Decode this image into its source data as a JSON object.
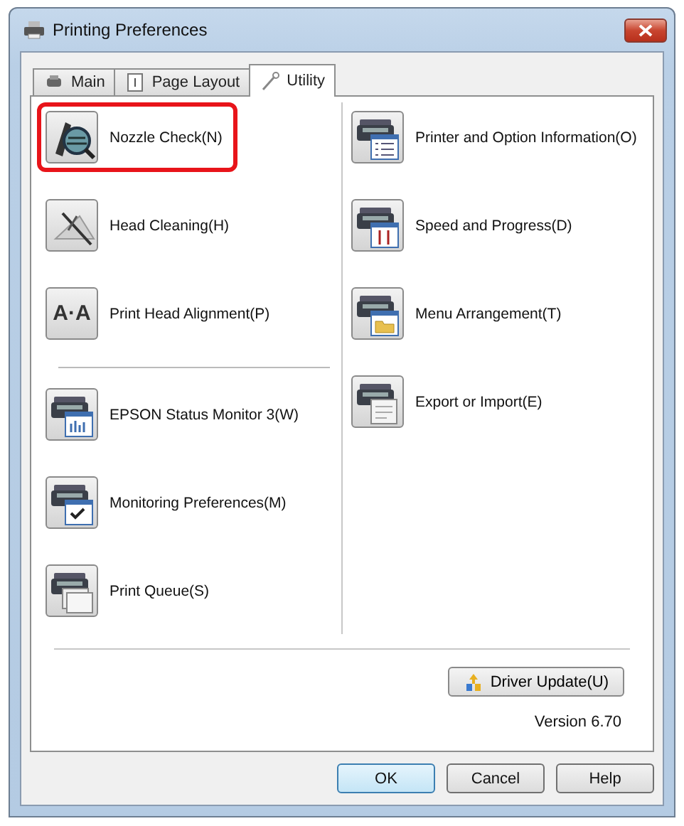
{
  "window": {
    "title": "Printing Preferences"
  },
  "tabs": [
    {
      "label": "Main",
      "selected": false
    },
    {
      "label": "Page Layout",
      "selected": false
    },
    {
      "label": "Utility",
      "selected": true
    }
  ],
  "left_groups": [
    [
      {
        "label": "Nozzle Check(N)",
        "kind": "nozzle",
        "highlighted": true
      },
      {
        "label": "Head Cleaning(H)",
        "kind": "cleaning",
        "highlighted": false
      },
      {
        "label": "Print Head Alignment(P)",
        "kind": "alignment",
        "icon_text": "A·A",
        "highlighted": false
      }
    ],
    [
      {
        "label": "EPSON Status Monitor 3(W)",
        "kind": "monitor",
        "highlighted": false
      },
      {
        "label": "Monitoring Preferences(M)",
        "kind": "preferences",
        "highlighted": false
      },
      {
        "label": "Print Queue(S)",
        "kind": "queue",
        "highlighted": false
      }
    ]
  ],
  "right_items": [
    {
      "label": "Printer and Option Information(O)",
      "kind": "info",
      "highlighted": false
    },
    {
      "label": "Speed and Progress(D)",
      "kind": "speed",
      "highlighted": false
    },
    {
      "label": "Menu Arrangement(T)",
      "kind": "menu",
      "highlighted": false
    },
    {
      "label": "Export or Import(E)",
      "kind": "export",
      "highlighted": false
    }
  ],
  "driver_update": {
    "label": "Driver Update(U)"
  },
  "version": "Version 6.70",
  "buttons": [
    {
      "label": "OK",
      "default": true
    },
    {
      "label": "Cancel",
      "default": false
    },
    {
      "label": "Help",
      "default": false
    }
  ]
}
